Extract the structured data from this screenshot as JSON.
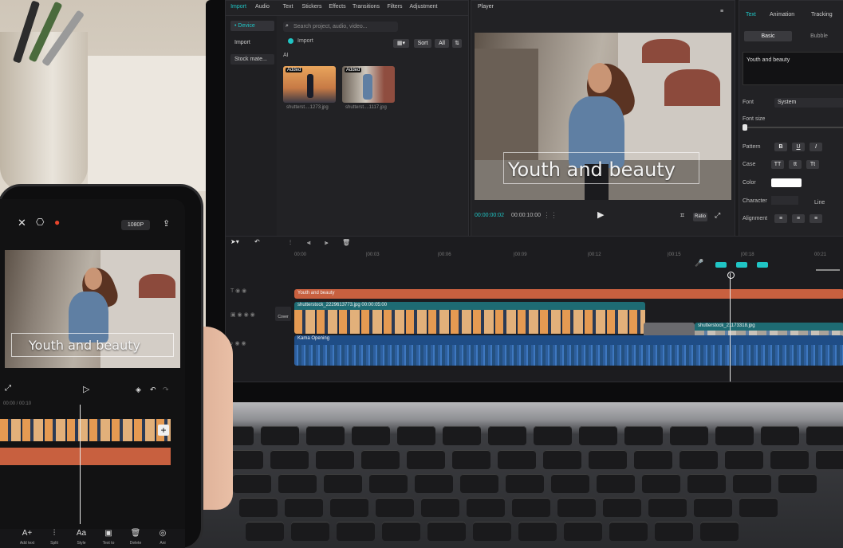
{
  "desktop": {
    "top_tabs": [
      "Import",
      "Audio",
      "Text",
      "Stickers",
      "Effects",
      "Transitions",
      "Filters",
      "Adjustment"
    ],
    "sidebar": [
      "• Device",
      "Import",
      "Stock mate..."
    ],
    "search_placeholder": "Search project, audio, video...",
    "media_toolbar": {
      "sort": "Sort",
      "all": "All"
    },
    "import_label": "Import",
    "ai_label": "AI",
    "media": [
      {
        "badge": "Added",
        "name": "shutterst....1273.jpg"
      },
      {
        "badge": "Added",
        "name": "shutterst....1117.jpg"
      }
    ],
    "player": {
      "title": "Player",
      "caption": "Youth and beauty",
      "time_current": "00:00:00:02",
      "time_total": "00:00:10:00",
      "ratio_label": "Ratio"
    },
    "properties": {
      "tabs": [
        "Text",
        "Animation",
        "Tracking"
      ],
      "subtabs": [
        "Basic",
        "Bubble"
      ],
      "text_value": "Youth and beauty",
      "font_label": "Font",
      "font_value": "System",
      "font_size_label": "Font size",
      "pattern_label": "Pattern",
      "pattern_buttons": [
        "B",
        "U",
        "I"
      ],
      "case_label": "Case",
      "case_buttons": [
        "TT",
        "tt",
        "Tt"
      ],
      "color_label": "Color",
      "character_label": "Character",
      "line_label": "Line",
      "alignment_label": "Alignment",
      "text_color": "#ffffff"
    },
    "timeline": {
      "ruler": [
        "00:00",
        "|00:03",
        "|00:06",
        "|00:09",
        "|00:12",
        "|00:15",
        "|00:18",
        "00:21"
      ],
      "text_track_label": "Youth and beauty",
      "video_track_label": "shutterstock_2229613773.jpg 00:00:05:00",
      "video_track2_label": "shutterstock_21173318.jpg",
      "audio_track_label": "Kama Opening",
      "cover_label": "Cover",
      "colors": {
        "text_track": "#c8603f",
        "video_track": "#1e6b73",
        "audio_track": "#1f4d86",
        "accent": "#20c5c5"
      }
    }
  },
  "phone": {
    "resolution": "1080P",
    "caption": "Youth and beauty",
    "time": "00:00 / 00:10",
    "toolbar": [
      "Add text",
      "Split",
      "Style",
      "Text to",
      "Delete",
      "Ani"
    ]
  }
}
